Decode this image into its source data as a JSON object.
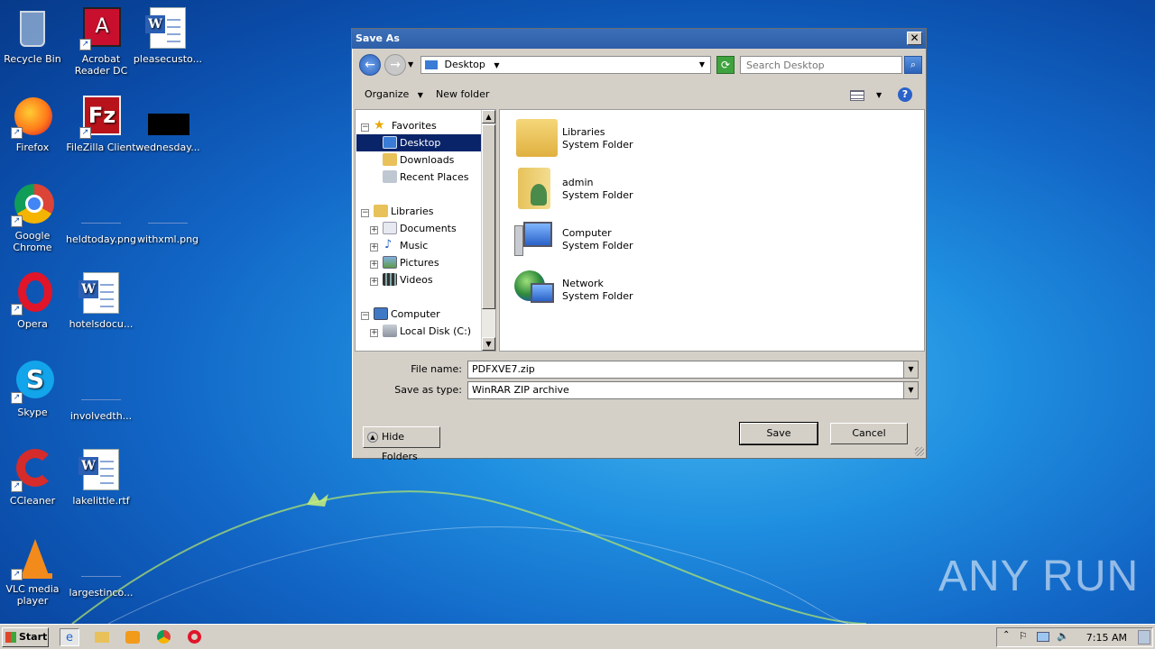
{
  "desktop": {
    "icons": [
      {
        "label": "Recycle Bin"
      },
      {
        "label": "Acrobat Reader DC"
      },
      {
        "label": "pleasecusto..."
      },
      {
        "label": "Firefox"
      },
      {
        "label": "FileZilla Client"
      },
      {
        "label": "wednesday..."
      },
      {
        "label": "Google Chrome"
      },
      {
        "label": "heldtoday.png"
      },
      {
        "label": "withxml.png"
      },
      {
        "label": "Opera"
      },
      {
        "label": "hotelsdocu..."
      },
      {
        "label": "Skype"
      },
      {
        "label": "involvedth..."
      },
      {
        "label": "CCleaner"
      },
      {
        "label": "lakelittle.rtf"
      },
      {
        "label": "VLC media player"
      },
      {
        "label": "largestinco..."
      }
    ],
    "watermark": "ANY RUN"
  },
  "dialog": {
    "title": "Save As",
    "close": "✕",
    "address": {
      "location": "Desktop"
    },
    "search": {
      "placeholder": "Search Desktop"
    },
    "toolbar": {
      "organize": "Organize",
      "new_folder": "New folder",
      "help": "?"
    },
    "tree": {
      "favorites": "Favorites",
      "desktop": "Desktop",
      "downloads": "Downloads",
      "recent_places": "Recent Places",
      "libraries": "Libraries",
      "documents": "Documents",
      "music": "Music",
      "pictures": "Pictures",
      "videos": "Videos",
      "computer": "Computer",
      "local_disk": "Local Disk (C:)"
    },
    "items": [
      {
        "name": "Libraries",
        "type": "System Folder"
      },
      {
        "name": "admin",
        "type": "System Folder"
      },
      {
        "name": "Computer",
        "type": "System Folder"
      },
      {
        "name": "Network",
        "type": "System Folder"
      }
    ],
    "file_name_label": "File name:",
    "file_name_value": "PDFXVE7.zip",
    "save_type_label": "Save as type:",
    "save_type_value": "WinRAR ZIP archive",
    "hide_folders": "Hide Folders",
    "save_button": "Save",
    "cancel_button": "Cancel"
  },
  "taskbar": {
    "start": "Start",
    "clock": "7:15 AM"
  }
}
